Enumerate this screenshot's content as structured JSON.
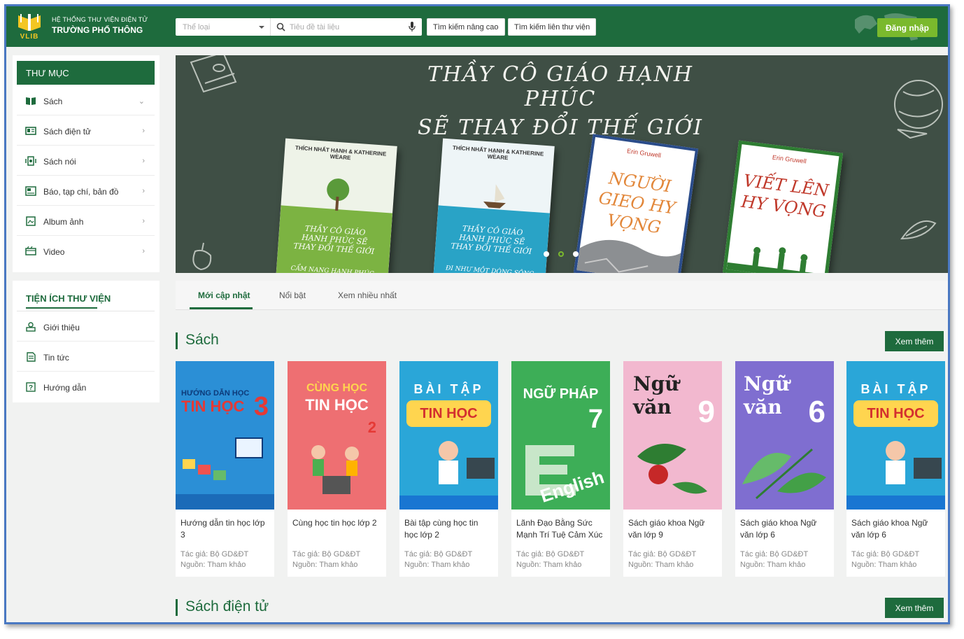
{
  "header": {
    "logo_text": "VLIB",
    "brand_line1": "HỆ THỐNG THƯ VIỆN ĐIỆN TỬ",
    "brand_line2": "TRƯỜNG PHỔ THÔNG",
    "category_placeholder": "Thể loại",
    "search_placeholder": "Tiêu đề tài liệu",
    "advanced_search": "Tìm kiếm nâng cao",
    "inter_library_search": "Tìm kiếm liên thư viện",
    "login": "Đăng nhập",
    "colors": {
      "primary": "#1e6b3d",
      "login": "#7ab92d"
    }
  },
  "sidebar": {
    "directory_title": "THƯ MỤC",
    "items": [
      {
        "label": "Sách",
        "icon": "book-open-icon",
        "expand": "chevron-down"
      },
      {
        "label": "Sách điện tử",
        "icon": "ebook-icon",
        "expand": "chevron-right"
      },
      {
        "label": "Sách nói",
        "icon": "audio-book-icon",
        "expand": "chevron-right"
      },
      {
        "label": "Báo, tạp chí, bản đồ",
        "icon": "newspaper-icon",
        "expand": "chevron-right"
      },
      {
        "label": "Album ảnh",
        "icon": "photo-album-icon",
        "expand": "chevron-right"
      },
      {
        "label": "Video",
        "icon": "video-icon",
        "expand": "chevron-right"
      }
    ],
    "utilities_title": "TIỆN ÍCH THƯ VIỆN",
    "utilities": [
      {
        "label": "Giới thiệu",
        "icon": "intro-icon"
      },
      {
        "label": "Tin tức",
        "icon": "news-icon"
      },
      {
        "label": "Hướng dẫn",
        "icon": "help-icon"
      }
    ]
  },
  "banner": {
    "title_line1": "THẦY CÔ GIÁO HẠNH PHÚC",
    "title_line2": "SẼ THAY ĐỔI THẾ GIỚI",
    "books": [
      {
        "top": "THÍCH NHẤT HẠNH & KATHERINE WEARE",
        "title": "THẦY CÔ GIÁO HẠNH PHÚC SẼ THAY ĐỔI THẾ GIỚI",
        "sub": "CẨM NANG HẠNH PHÚC"
      },
      {
        "top": "THÍCH NHẤT HẠNH & KATHERINE WEARE",
        "title": "THẦY CÔ GIÁO HẠNH PHÚC SẼ THAY ĐỔI THẾ GIỚI",
        "sub": "ĐI NHƯ MỘT DÒNG SÔNG"
      },
      {
        "top": "Erin Gruwell",
        "title": "NGƯỜI GIEO HY VỌNG"
      },
      {
        "top": "Erin Gruwell",
        "title": "VIẾT LÊN HY VỌNG"
      }
    ],
    "slides": 3,
    "active_slide": 2
  },
  "tabs": [
    "Mới cập nhật",
    "Nổi bật",
    "Xem nhiều nhất"
  ],
  "sections": {
    "books_title": "Sách",
    "ebooks_title": "Sách điện tử",
    "see_more": "Xem thêm"
  },
  "books": [
    {
      "title": "Hướng dẫn tin học lớp 3",
      "author": "Tác giả: Bộ GD&ĐT",
      "source": "Nguồn: Tham khảo",
      "cover_text1": "HƯỚNG DẪN HỌC",
      "cover_text2": "TIN HỌC",
      "cover_num": "3",
      "cover_color": "#2b8fd6"
    },
    {
      "title": "Cùng học tin học lớp 2",
      "author": "Tác giả: Bộ GD&ĐT",
      "source": "Nguồn: Tham khảo",
      "cover_text1": "CÙNG HỌC",
      "cover_text2": "TIN HỌC",
      "cover_num": "2",
      "cover_color": "#ee6f72"
    },
    {
      "title": "Bài tập cùng học tin học lớp 2",
      "author": "Tác giả: Bộ GD&ĐT",
      "source": "Nguồn: Tham khảo",
      "cover_text1": "BÀI TẬP",
      "cover_text2": "TIN HỌC",
      "cover_num": "",
      "cover_color": "#2aa6d8"
    },
    {
      "title": "Lãnh Đạo Bằng Sức Mạnh Trí Tuệ Cảm Xúc",
      "author": "Tác giả: Bộ GD&ĐT",
      "source": "Nguồn: Tham khảo",
      "cover_text1": "NGỮ PHÁP",
      "cover_text2": "English",
      "cover_num": "7",
      "cover_color": "#3dae57"
    },
    {
      "title": "Sách giáo khoa Ngữ văn lớp 9",
      "author": "Tác giả: Bộ GD&ĐT",
      "source": "Nguồn: Tham khảo",
      "cover_text1": "Ngữ văn",
      "cover_text2": "",
      "cover_num": "9",
      "cover_color": "#f2b8cf"
    },
    {
      "title": "Sách giáo khoa Ngữ văn lớp 6",
      "author": "Tác giả: Bộ GD&ĐT",
      "source": "Nguồn: Tham khảo",
      "cover_text1": "Ngữ văn",
      "cover_text2": "",
      "cover_num": "6",
      "cover_color": "#7f6ed0"
    },
    {
      "title": "Sách giáo khoa Ngữ văn lớp 6",
      "author": "Tác giả: Bộ GD&ĐT",
      "source": "Nguồn: Tham khảo",
      "cover_text1": "BÀI TẬP",
      "cover_text2": "TIN HỌC",
      "cover_num": "",
      "cover_color": "#2aa6d8"
    }
  ]
}
